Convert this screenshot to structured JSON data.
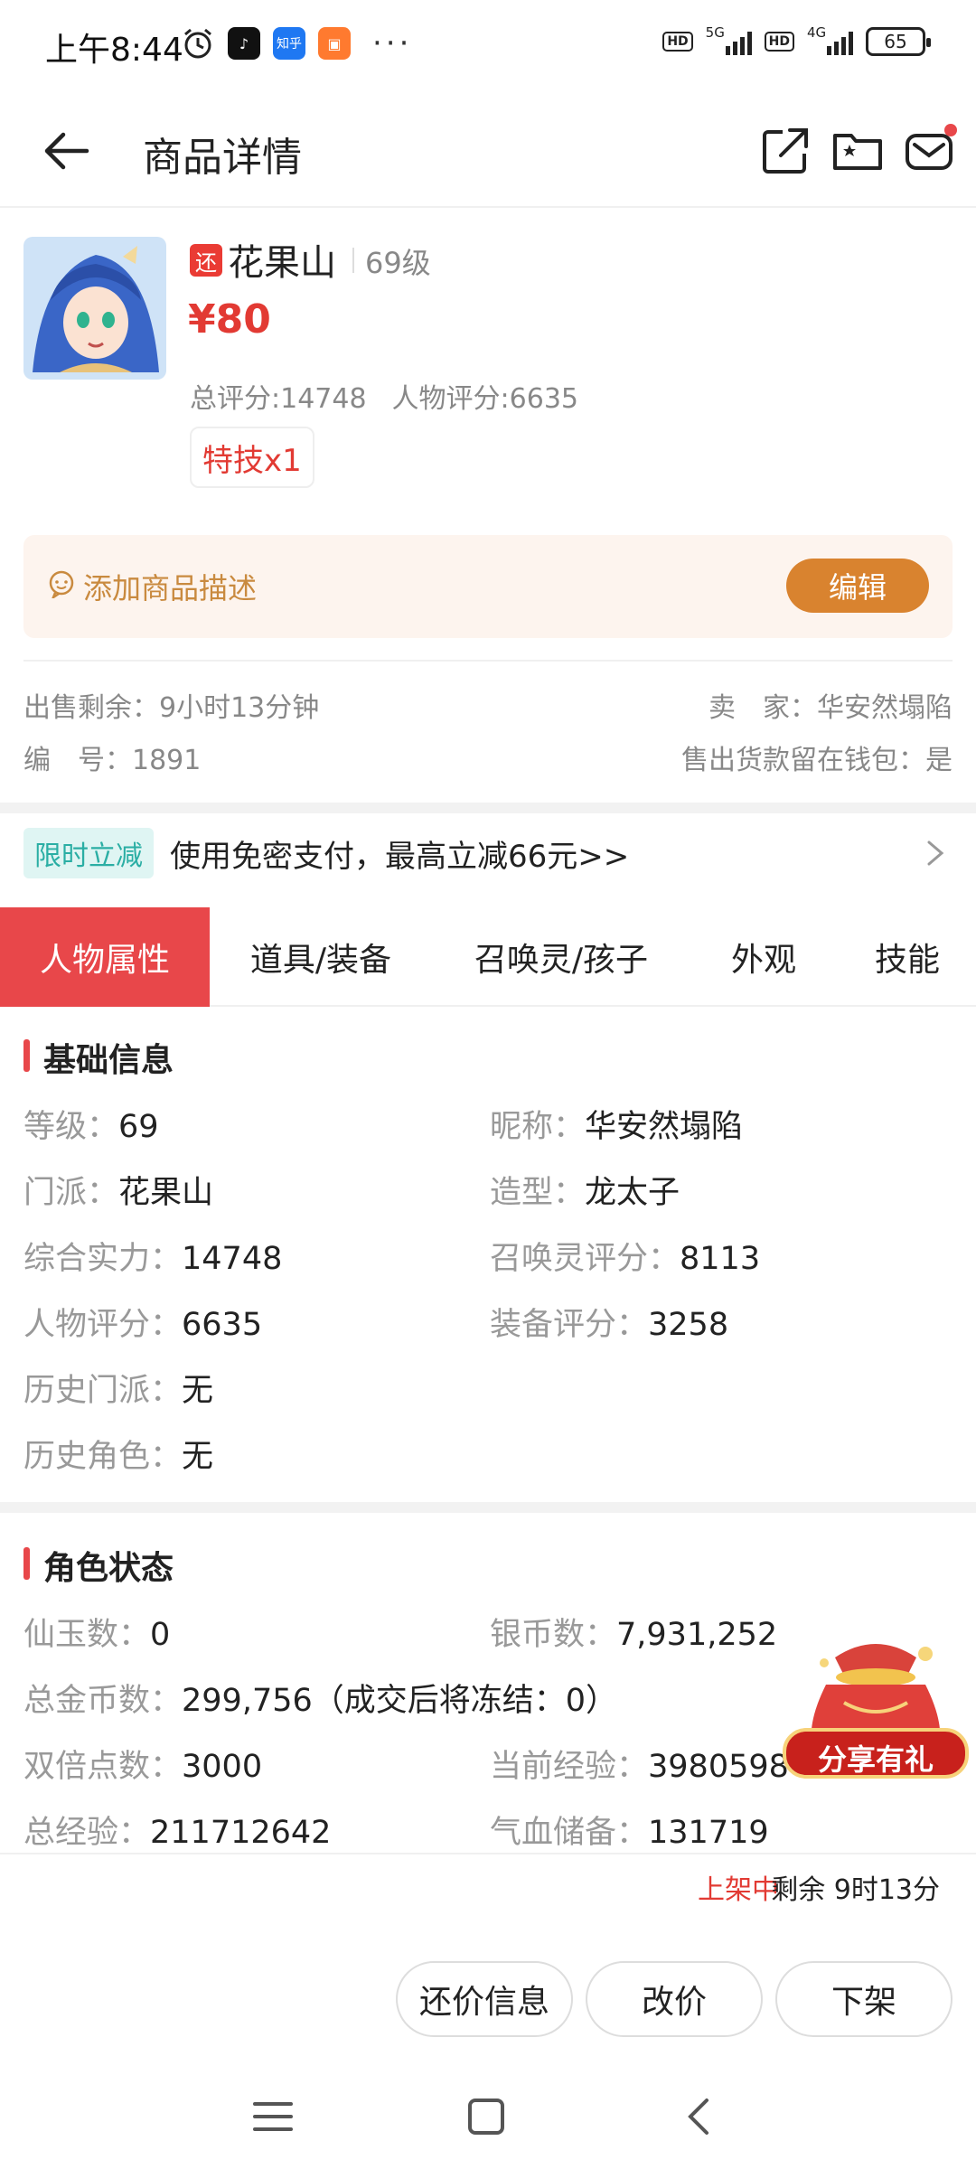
{
  "status_bar": {
    "time": "上午8:44",
    "app_zhihu": "知乎",
    "battery": "65",
    "net1": "5G",
    "net2": "4G",
    "hd": "HD",
    "more": "···"
  },
  "header": {
    "title": "商品详情"
  },
  "product": {
    "tag": "还",
    "server": "花果山",
    "level": "69级",
    "price": "¥80",
    "total_score": "总评分:14748",
    "char_score": "人物评分:6635",
    "skill_tag": "特技x1"
  },
  "description": {
    "placeholder": "添加商品描述",
    "edit_label": "编辑"
  },
  "meta": {
    "remaining": "出售剩余：9小时13分钟",
    "seller": "卖　家：华安然塌陷",
    "serial": "编　号：1891",
    "wallet": "售出货款留在钱包：是"
  },
  "promo": {
    "tag": "限时立减",
    "text": "使用免密支付，最高立减66元>>"
  },
  "tabs": [
    "人物属性",
    "道具/装备",
    "召唤灵/孩子",
    "外观",
    "技能"
  ],
  "basic_info": {
    "title": "基础信息",
    "left": [
      {
        "k": "等级：",
        "v": "69"
      },
      {
        "k": "门派：",
        "v": "花果山"
      },
      {
        "k": "综合实力：",
        "v": "14748"
      },
      {
        "k": "人物评分：",
        "v": "6635"
      },
      {
        "k": "历史门派：",
        "v": "无"
      },
      {
        "k": "历史角色：",
        "v": "无"
      }
    ],
    "right": [
      {
        "k": "昵称：",
        "v": "华安然塌陷"
      },
      {
        "k": "造型：",
        "v": "龙太子"
      },
      {
        "k": "召唤灵评分：",
        "v": "8113"
      },
      {
        "k": "装备评分：",
        "v": "3258"
      }
    ]
  },
  "role_status": {
    "title": "角色状态",
    "rows": [
      {
        "k": "仙玉数：",
        "v": "0"
      },
      {
        "k": "银币数：",
        "v": "7,931,252"
      },
      {
        "k": "总金币数：",
        "v": "299,756（成交后将冻结：0）"
      },
      {
        "k": "双倍点数：",
        "v": "3000"
      },
      {
        "k": "当前经验：",
        "v": "3980598"
      },
      {
        "k": "总经验：",
        "v": "211712642"
      },
      {
        "k": "气血储备：",
        "v": "131719"
      }
    ]
  },
  "gift": {
    "label": "分享有礼"
  },
  "bottom": {
    "status": "上架中",
    "remaining": "剩余 9时13分",
    "buttons": [
      "还价信息",
      "改价",
      "下架"
    ]
  },
  "colors": {
    "accent_red": "#e8474a",
    "price_red": "#e23a33",
    "edit_orange": "#d9832f",
    "promo_teal": "#2aaea4"
  }
}
